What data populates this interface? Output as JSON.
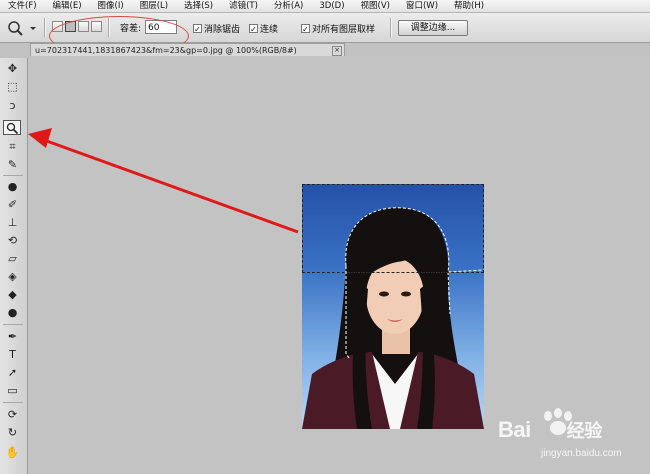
{
  "menubar": {
    "items": [
      "文件(F)",
      "编辑(E)",
      "图像(I)",
      "图层(L)",
      "选择(S)",
      "滤镜(T)",
      "分析(A)",
      "3D(D)",
      "视图(V)",
      "窗口(W)",
      "帮助(H)"
    ]
  },
  "options": {
    "tolerance_label": "容差:",
    "tolerance_value": "60",
    "antialias_label": "消除锯齿",
    "contiguous_label": "连续",
    "sample_all_label": "对所有图层取样",
    "refine_edge_label": "调整边缘...",
    "check_mark": "✓"
  },
  "document": {
    "tab_title": "u=702317441,1831867423&fm=23&gp=0.jpg @ 100%(RGB/8#)",
    "close_glyph": "×"
  },
  "watermark": {
    "brand": "Bai",
    "brand_suffix": "经验",
    "url": "jingyan.baidu.com"
  },
  "colors": {
    "arrow": "#e01818",
    "highlight": "#d44b4b"
  },
  "icons": [
    "move-icon",
    "marquee-icon",
    "lasso-icon",
    "magic-wand-icon",
    "crop-icon",
    "eyedropper-icon",
    "spot-heal-icon",
    "brush-icon",
    "stamp-icon",
    "history-brush-icon",
    "eraser-icon",
    "bucket-icon",
    "blur-icon",
    "dodge-icon",
    "pen-icon",
    "type-icon",
    "path-select-icon",
    "shape-icon",
    "3d-rotate-icon",
    "3d-orbit-icon",
    "hand-icon"
  ]
}
